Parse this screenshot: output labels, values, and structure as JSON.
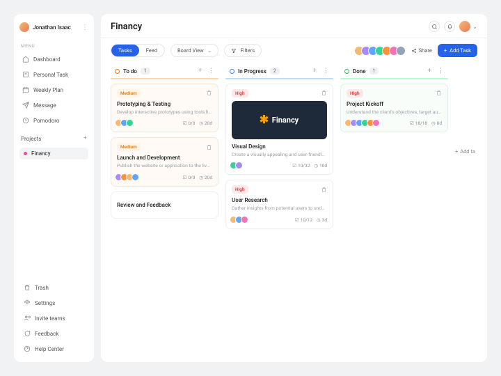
{
  "user": {
    "name": "Jonathan Isaac"
  },
  "sidebar": {
    "menu_label": "MENU",
    "items": [
      {
        "label": "Dashboard"
      },
      {
        "label": "Personal Task"
      },
      {
        "label": "Weekly Plan"
      },
      {
        "label": "Message"
      },
      {
        "label": "Pomodoro"
      }
    ],
    "projects_label": "Projects",
    "projects": [
      {
        "label": "Financy"
      }
    ],
    "footer": [
      {
        "label": "Trash"
      },
      {
        "label": "Settings"
      },
      {
        "label": "Invite teams"
      },
      {
        "label": "Feedback"
      },
      {
        "label": "Help Center"
      }
    ]
  },
  "header": {
    "title": "Financy"
  },
  "toolbar": {
    "tasks": "Tasks",
    "feed": "Feed",
    "view": "Board View",
    "filters": "Filters",
    "share": "Share",
    "add_task": "Add Task"
  },
  "columns": {
    "todo": {
      "title": "To do",
      "count": "1"
    },
    "progress": {
      "title": "In Progress",
      "count": "2"
    },
    "done": {
      "title": "Done",
      "count": "1"
    },
    "add": "Add ta"
  },
  "cards": {
    "c1": {
      "priority": "Medium",
      "title": "Prototyping & Testing",
      "desc": "Develop interactive prototypes using tools like S…",
      "sub": "0/0",
      "time": "20d"
    },
    "c2": {
      "priority": "Medium",
      "title": "Launch and Development",
      "desc": "Publish the website or application to the live ser…",
      "sub": "0/0",
      "time": "20d"
    },
    "c3": {
      "title": "Review and Feedback"
    },
    "c4": {
      "priority": "High",
      "cover_text": "Financy",
      "title": "Visual Design",
      "desc": "Create a visually appealing and user-friendly lan…",
      "sub": "10/32",
      "time": "10d"
    },
    "c5": {
      "priority": "High",
      "title": "User Research",
      "desc": "Gather insights from potential users to understa…",
      "sub": "10/12",
      "time": "3d"
    },
    "c6": {
      "priority": "High",
      "title": "Project Kickoff",
      "desc": "Understand the client's objectives, target audien…",
      "sub": "18/18",
      "time": "0d"
    }
  }
}
